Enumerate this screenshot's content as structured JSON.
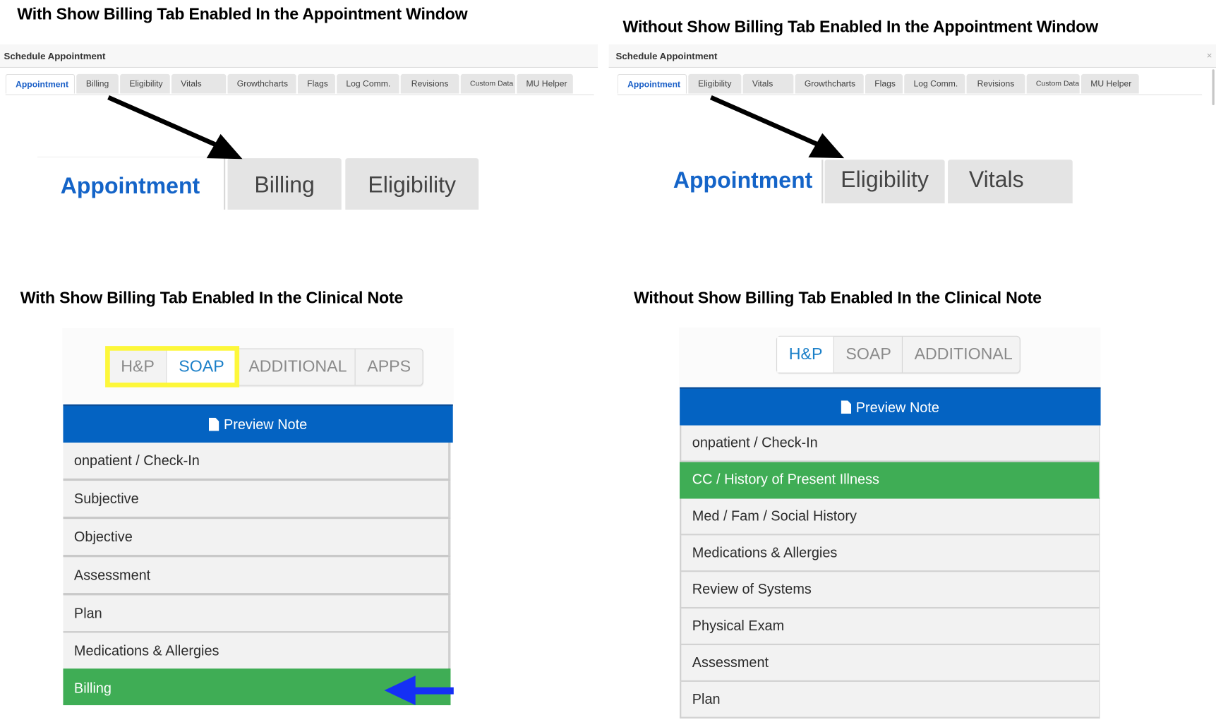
{
  "headings": {
    "appt_with": "With Show Billing Tab Enabled In the Appointment Window",
    "appt_without": "Without Show Billing Tab Enabled In the Appointment Window",
    "note_with": "With Show Billing Tab Enabled In the Clinical Note",
    "note_without": "Without Show Billing Tab Enabled In the Clinical Note"
  },
  "appointment_with": {
    "window_title": "Schedule Appointment",
    "active_tab": "Appointment",
    "tabs": [
      {
        "label": "Appointment"
      },
      {
        "label": "Billing"
      },
      {
        "label": "Eligibility"
      },
      {
        "label": "Vitals"
      },
      {
        "label": "Growthcharts"
      },
      {
        "label": "Flags"
      },
      {
        "label": "Log Comm."
      },
      {
        "label": "Revisions"
      },
      {
        "label": "Custom Data"
      },
      {
        "label": "MU Helper"
      }
    ],
    "zoom_tabs": [
      {
        "label": "Appointment"
      },
      {
        "label": "Billing"
      },
      {
        "label": "Eligibility"
      }
    ]
  },
  "appointment_without": {
    "window_title": "Schedule Appointment",
    "close_glyph": "×",
    "active_tab": "Appointment",
    "tabs": [
      {
        "label": "Appointment"
      },
      {
        "label": "Eligibility"
      },
      {
        "label": "Vitals"
      },
      {
        "label": "Growthcharts"
      },
      {
        "label": "Flags"
      },
      {
        "label": "Log Comm."
      },
      {
        "label": "Revisions"
      },
      {
        "label": "Custom Data"
      },
      {
        "label": "MU Helper"
      }
    ],
    "zoom_tabs": [
      {
        "label": "Appointment"
      },
      {
        "label": "Eligibility"
      },
      {
        "label": "Vitals"
      }
    ]
  },
  "note_with": {
    "segments": [
      {
        "label": "H&P"
      },
      {
        "label": "SOAP"
      },
      {
        "label": "ADDITIONAL"
      },
      {
        "label": "APPS"
      }
    ],
    "active_segment": "SOAP",
    "preview_label": "Preview Note",
    "items": [
      {
        "label": "onpatient / Check-In",
        "completed": false
      },
      {
        "label": "Subjective",
        "completed": false
      },
      {
        "label": "Objective",
        "completed": false
      },
      {
        "label": "Assessment",
        "completed": false
      },
      {
        "label": "Plan",
        "completed": false
      },
      {
        "label": "Medications & Allergies",
        "completed": false
      },
      {
        "label": "Billing",
        "completed": true
      }
    ]
  },
  "note_without": {
    "segments": [
      {
        "label": "H&P"
      },
      {
        "label": "SOAP"
      },
      {
        "label": "ADDITIONAL"
      }
    ],
    "active_segment": "H&P",
    "preview_label": "Preview Note",
    "items": [
      {
        "label": "onpatient / Check-In",
        "completed": false
      },
      {
        "label": "CC / History of Present Illness",
        "completed": true
      },
      {
        "label": "Med / Fam / Social History",
        "completed": false
      },
      {
        "label": "Medications & Allergies",
        "completed": false
      },
      {
        "label": "Review of Systems",
        "completed": false
      },
      {
        "label": "Physical Exam",
        "completed": false
      },
      {
        "label": "Assessment",
        "completed": false
      },
      {
        "label": "Plan",
        "completed": false
      }
    ]
  },
  "annotations": {
    "highlight_color": "#fdf73a",
    "pointer_arrow_color": "#000000",
    "billing_arrow_color": "#1530f5"
  },
  "colors": {
    "active_tab_text": "#1464c8",
    "preview_button": "#0463c2",
    "completed_item": "#3fad55",
    "active_segment_text": "#1a7fc8"
  }
}
